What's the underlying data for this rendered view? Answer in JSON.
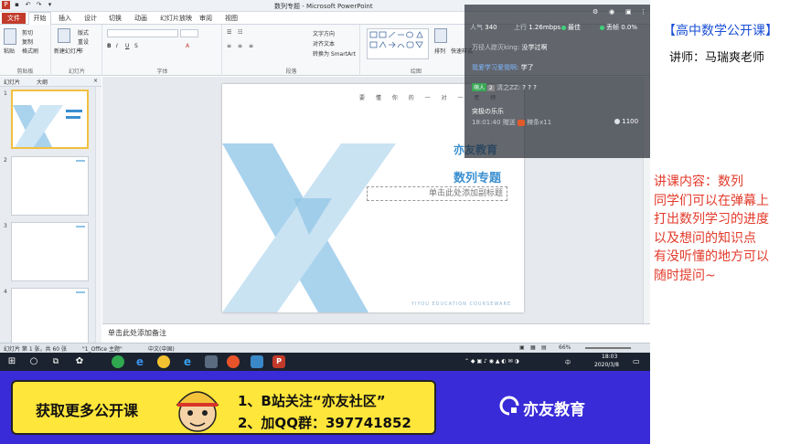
{
  "window": {
    "title": "数列专题 - Microsoft PowerPoint",
    "ribbon_tabs": [
      {
        "label": "文件"
      },
      {
        "label": "开始"
      },
      {
        "label": "插入"
      },
      {
        "label": "设计"
      },
      {
        "label": "切换"
      },
      {
        "label": "动画"
      },
      {
        "label": "幻灯片放映"
      },
      {
        "label": "审阅"
      },
      {
        "label": "视图"
      }
    ]
  },
  "ribbon": {
    "clipboard": {
      "label": "剪贴板",
      "paste": "粘贴",
      "cut": "剪切",
      "copy": "复制",
      "format_painter": "格式刷"
    },
    "slides": {
      "label": "幻灯片",
      "new_slide": "新建幻灯片",
      "layout": "版式",
      "reset": "重设",
      "section": "节"
    },
    "font": {
      "label": "字体"
    },
    "paragraph": {
      "label": "段落",
      "text_direction": "文字方向",
      "align_text": "对齐文本",
      "smartart": "转换为 SmartArt"
    },
    "drawing": {
      "label": "绘图",
      "arrange": "排列",
      "quick_styles": "快速样式"
    }
  },
  "panel": {
    "tab_slides": "幻灯片",
    "tab_outline": "大纲",
    "slide_numbers": [
      "1",
      "2",
      "3",
      "4"
    ]
  },
  "slide": {
    "motto": "要 懂 你 的 一 对 一 老 师",
    "brand": "亦友教育",
    "title": "数列专题",
    "subtitle_placeholder": "单击此处添加副标题",
    "footer": "YIYOU EDUCATION COURSEWARE",
    "accent_color": "#8fc4e6"
  },
  "notes_placeholder": "单击此处添加备注",
  "status": {
    "slide_info": "幻灯片 第 1 张，共 60 张",
    "theme": "\"1_Office 主题\"",
    "language": "中文(中国)",
    "zoom": "66%"
  },
  "chat": {
    "viewers_label": "人气",
    "viewers": "340",
    "upload_label": "上行",
    "upload": "1.26mbps",
    "quality": "最佳",
    "drop_label": "丢帧",
    "drop": "0.0%",
    "messages": [
      {
        "user": "万径人踪灭king",
        "text": "没学过啊"
      },
      {
        "user": "我爱学习爱我啊",
        "text": "学了"
      },
      {
        "badge": "萌人",
        "level": "2",
        "user": "清之ZZ",
        "text": "? ? ?"
      }
    ],
    "gift_user": "突极の乐乐",
    "gift_time": "18:01:40",
    "gift_action": "赠送",
    "gift_item": "辣条x11",
    "gift_score": "1100"
  },
  "teacher_panel": {
    "course": "【高中数学公开课】",
    "teacher": "讲师：马瑞爽老师",
    "lecture_lines": [
      "讲课内容：数列",
      "同学们可以在弹幕上",
      "打出数列学习的进度",
      "以及想问的知识点",
      "有没听懂的地方可以",
      "随时提问~"
    ]
  },
  "taskbar": {
    "time": "18:03",
    "date": "2020/3/8",
    "ime": "中"
  },
  "banner": {
    "left": "获取更多公开课",
    "line1": "1、B站关注“亦友社区”",
    "line2": "2、加QQ群：397741852",
    "logo": "亦友教育",
    "bg_color": "#3a2bd8",
    "box_color": "#ffe63a"
  }
}
